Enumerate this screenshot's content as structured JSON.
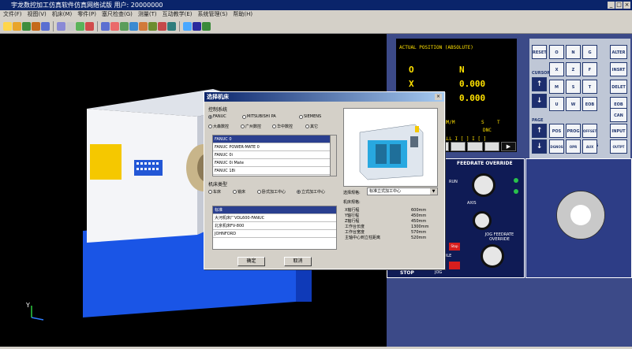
{
  "window": {
    "title": "宇龙数控加工仿真软件仿真网络试版  用户: 20000000",
    "btn_min": "_",
    "btn_max": "□",
    "btn_close": "×"
  },
  "menu": [
    "文件(F)",
    "视图(V)",
    "机床(M)",
    "零件(P)",
    "塞尺检查(G)",
    "测量(T)",
    "互动教学(E)",
    "系统管理(S)",
    "帮助(H)"
  ],
  "toolbar": {
    "icons": [
      "new-file-icon",
      "open-icon",
      "save-icon",
      "machine-icon",
      "cnc-icon",
      "workpiece-icon",
      "fixture-icon",
      "tool-icon",
      "measure-icon",
      "zoom-icon",
      "rotate-icon",
      "pan-icon",
      "view-front-icon",
      "view-top-icon",
      "view-left-icon",
      "view-right-icon",
      "reset-icon",
      "window-icon",
      "display-icon",
      "layout-icon"
    ]
  },
  "screen": {
    "header": "ACTUAL  POSITION (ABSOLUTE)",
    "o_label": "O",
    "n_label": "N",
    "x_label": "X",
    "x_value": "0.000",
    "z_label": "Z",
    "z_value": "0.000",
    "mm_label": "MM/M",
    "s_label": "S",
    "t_label": "T",
    "mode": "DNC",
    "all": "ALL I [  ]  I [  ]"
  },
  "keypad": {
    "reset": "RESET",
    "cursor": "CURSOR",
    "page": "PAGE",
    "keys": [
      {
        "t": "O",
        "s": "P"
      },
      {
        "t": "N",
        "s": "Q"
      },
      {
        "t": "G",
        "s": "R"
      },
      {
        "t": "X",
        "s": "C"
      },
      {
        "t": "Z",
        "s": "Y"
      },
      {
        "t": "F",
        "s": "L"
      },
      {
        "t": "M",
        "s": "I"
      },
      {
        "t": "S",
        "s": "K"
      },
      {
        "t": "T",
        "s": "J"
      },
      {
        "t": "U",
        "s": "H"
      },
      {
        "t": "W",
        "s": "V"
      },
      {
        "t": "EOB",
        "s": "E"
      }
    ],
    "nums": [
      "7",
      "8",
      "9",
      "4",
      "5",
      "6",
      "1",
      "2",
      "3",
      "-",
      "0",
      "."
    ],
    "right": [
      "ALTER",
      "INSRT",
      "DELET",
      "EOB",
      "CAN",
      "INPUT",
      "OUTPT START"
    ],
    "func": [
      "POS",
      "PROG",
      "OFFSET SETTING",
      "SHIFT",
      "DGNOS PARAM",
      "OPR ALARM",
      "AUX GRAPH"
    ]
  },
  "operator": {
    "feed_override": "FEEDRATE OVERRIDE",
    "run": "RUN",
    "axis": "AXIS",
    "stop": "STOP",
    "jog_feed": "JOG FEEDRATE OVERRIDE",
    "jog": "JOG",
    "stop_btn": "Stop",
    "idle": "IDLE",
    "feed_ticks": [
      "0",
      "20",
      "40",
      "60",
      "80",
      "100",
      "110",
      "120",
      "130"
    ],
    "jog_ticks": [
      "0",
      "2",
      "4",
      "6",
      "10",
      "20",
      "40",
      "60",
      "100",
      "150",
      "200",
      "320",
      "400",
      "500",
      "600",
      "800",
      "1000",
      "1200",
      "1500",
      "2000"
    ]
  },
  "dialog": {
    "title": "选择机床",
    "close": "×",
    "control_label": "控制系统",
    "control_opts": [
      "FANUC",
      "MITSUBISHI PA",
      "SIEMENS",
      "大森数控",
      "广州数控",
      "华中数控",
      "其它"
    ],
    "control_selected": 0,
    "systems": [
      "FANUC 0",
      "FANUC POWER-MATE 0",
      "FANUC 0i",
      "FANUC 0i Mate",
      "FANUC 18i"
    ],
    "system_selected": 0,
    "type_label": "机床类型",
    "type_opts": [
      "车床",
      "铣床",
      "卧式加工中心",
      "立式加工中心"
    ],
    "type_selected": 3,
    "makers": [
      "标准",
      "大河机床厂VDL600-FANUC",
      "北京机床FV-800",
      "JOHNFORD"
    ],
    "maker_selected": 0,
    "spec_label": "选择规格:",
    "spec_value": "标准立式加工中心",
    "spec_title": "机床规格:",
    "specs": [
      {
        "k": "X轴行程",
        "v": "600mm"
      },
      {
        "k": "Y轴行程",
        "v": "450mm"
      },
      {
        "k": "Z轴行程",
        "v": "450mm"
      },
      {
        "k": "工作台长度",
        "v": "1300mm"
      },
      {
        "k": "工作台宽度",
        "v": "570mm"
      },
      {
        "k": "主轴中心到立柱距离",
        "v": "520mm"
      }
    ],
    "ok": "确定",
    "cancel": "取消"
  },
  "axis_label": "Y",
  "colors": {
    "machine_bed": "#1a55e6",
    "machine_body": "#ffffff",
    "accent_yellow": "#f5c800"
  }
}
